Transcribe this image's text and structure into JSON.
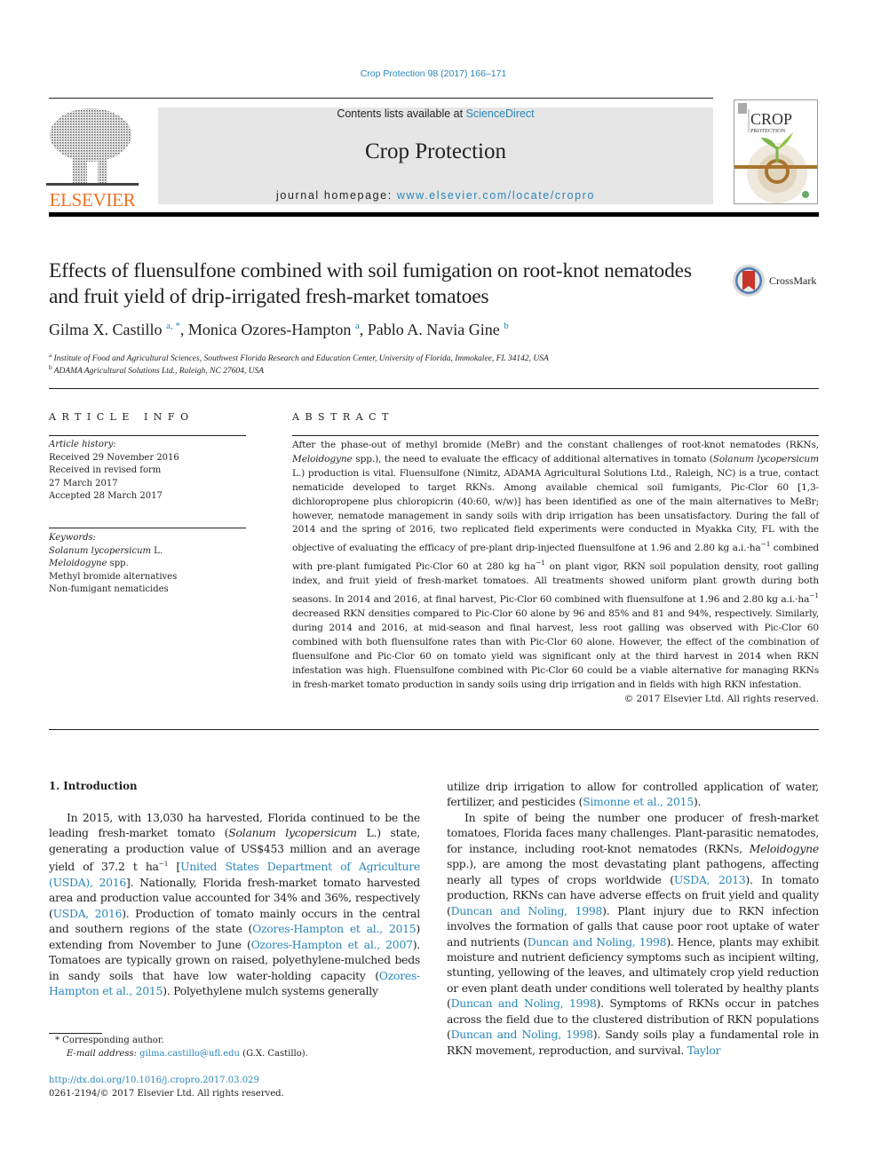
{
  "header": {
    "journal_ref": "Crop Protection 98 (2017) 166–171",
    "contents_prefix": "Contents lists available at ",
    "contents_link": "ScienceDirect",
    "journal_title": "Crop Protection",
    "homepage_prefix": "journal homepage: ",
    "homepage_link": "www.elsevier.com/locate/cropro",
    "publisher_logo_text": "ELSEVIER",
    "cover": {
      "title_line1": "CROP",
      "title_line2": "PROTECTION"
    },
    "crossmark_label": "CrossMark",
    "colors": {
      "link": "#2a86b8",
      "elsevier_orange": "#f37021",
      "masthead_bg": "#e6e6e6"
    }
  },
  "article": {
    "title": "Effects of fluensulfone combined with soil fumigation on root-knot nematodes and fruit yield of drip-irrigated fresh-market tomatoes",
    "authors": [
      {
        "name": "Gilma X. Castillo",
        "marks": "a, *"
      },
      {
        "name": "Monica Ozores-Hampton",
        "marks": "a"
      },
      {
        "name": "Pablo A. Navia Gine",
        "marks": "b"
      }
    ],
    "affiliations": [
      {
        "mark": "a",
        "text": "Institute of Food and Agricultural Sciences, Southwest Florida Research and Education Center, University of Florida, Immokalee, FL 34142, USA"
      },
      {
        "mark": "b",
        "text": "ADAMA Agricultural Solutions Ltd., Raleigh, NC 27604, USA"
      }
    ]
  },
  "article_info": {
    "heading": "ARTICLE INFO",
    "history_label": "Article history:",
    "history": [
      "Received 29 November 2016",
      "Received in revised form",
      "27 March 2017",
      "Accepted 28 March 2017"
    ],
    "keywords_label": "Keywords:",
    "keywords": [
      {
        "italic": "Solanum lycopersicum",
        "rest": " L."
      },
      {
        "italic": "Meloidogyne",
        "rest": " spp."
      },
      {
        "italic": "",
        "rest": "Methyl bromide alternatives"
      },
      {
        "italic": "",
        "rest": "Non-fumigant nematicides"
      }
    ]
  },
  "abstract": {
    "heading": "ABSTRACT",
    "p1": "After the phase-out of methyl bromide (MeBr) and the constant challenges of root-knot nematodes (RKNs, ",
    "p1_it": "Meloidogyne",
    "p2": " spp.), the need to evaluate the efficacy of additional alternatives in tomato (",
    "p2_it": "Solanum lycopersicum",
    "p3": " L.) production is vital. Fluensulfone (Nimitz, ADAMA Agricultural Solutions Ltd., Raleigh, NC) is a true, contact nematicide developed to target RKNs. Among available chemical soil fumigants, Pic-Clor 60 [1,3-dichloropropene plus chloropicrin (40:60, w/w)] has been identified as one of the main alternatives to MeBr; however, nematode management in sandy soils with drip irrigation has been unsatisfactory. During the fall of 2014 and the spring of 2016, two replicated field experiments were conducted in Myakka City, FL with the objective of evaluating the efficacy of pre-plant drip-injected fluensulfone at 1.96 and 2.80 kg a.i.·ha",
    "p4": " combined with pre-plant fumigated Pic-Clor 60 at 280 kg ha",
    "p5": " on plant vigor, RKN soil population density, root galling index, and fruit yield of fresh-market tomatoes. All treatments showed uniform plant growth during both seasons. In 2014 and 2016, at final harvest, Pic-Clor 60 combined with fluensulfone at 1.96 and 2.80 kg a.i.·ha",
    "p6": " decreased RKN densities compared to Pic-Clor 60 alone by 96 and 85% and 81 and 94%, respectively. Similarly, during 2014 and 2016, at mid-season and final harvest, less root galling was observed with Pic-Clor 60 combined with both fluensulfone rates than with Pic-Clor 60 alone. However, the effect of the combination of fluensulfone and Pic-Clor 60 on tomato yield was significant only at the third harvest in 2014 when RKN infestation was high. Fluensulfone combined with Pic-Clor 60 could be a viable alternative for managing RKNs in fresh-market tomato production in sandy soils using drip irrigation and in fields with high RKN infestation.",
    "exp": "−1",
    "copyright": "© 2017 Elsevier Ltd. All rights reserved."
  },
  "intro": {
    "heading": "1.  Introduction",
    "left": {
      "t1": "In 2015, with 13,030 ha harvested, Florida continued to be the leading fresh-market tomato (",
      "t1_it": "Solanum lycopersicum",
      "t2": " L.) state, generating a production value of US$453 million and an average yield of 37.2 t ha",
      "t2_sup": "−1",
      "t3": " [",
      "c1": "United States Department of Agriculture (USDA), 2016",
      "t4": "]. Nationally, Florida fresh-market tomato harvested area and production value accounted for 34% and 36%, respectively (",
      "c2": "USDA, 2016",
      "t5": "). Production of tomato mainly occurs in the central and southern regions of the state (",
      "c3": "Ozores-Hampton et al., 2015",
      "t6": ") extending from November to June (",
      "c4": "Ozores-Hampton et al., 2007",
      "t7": "). Tomatoes are typically grown on raised, polyethylene-mulched beds in sandy soils that have low water-holding capacity (",
      "c5": "Ozores-Hampton et al., 2015",
      "t8": "). Polyethylene mulch systems generally"
    },
    "right": {
      "t1": "utilize drip irrigation to allow for controlled application of water, fertilizer, and pesticides (",
      "c1": "Simonne et al., 2015",
      "t2": ").",
      "t3": "In spite of being the number one producer of fresh-market tomatoes, Florida faces many challenges. Plant-parasitic nematodes, for instance, including root-knot nematodes (RKNs, ",
      "t3_it": "Meloidogyne",
      "t4": " spp.), are among the most devastating plant pathogens, affecting nearly all types of crops worldwide (",
      "c2": "USDA, 2013",
      "t5": "). In tomato production, RKNs can have adverse effects on fruit yield and quality (",
      "c3": "Duncan and Noling, 1998",
      "t6": "). Plant injury due to RKN infection involves the formation of galls that cause poor root uptake of water and nutrients (",
      "c4": "Duncan and Noling, 1998",
      "t7": "). Hence, plants may exhibit moisture and nutrient deficiency symptoms such as incipient wilting, stunting, yellowing of the leaves, and ultimately crop yield reduction or even plant death under conditions well tolerated by healthy plants (",
      "c5": "Duncan and Noling, 1998",
      "t8": "). Symptoms of RKNs occur in patches across the field due to the clustered distribution of RKN populations (",
      "c6": "Duncan and Noling, 1998",
      "t9": "). Sandy soils play a fundamental role in RKN movement, reproduction, and survival. ",
      "c7": "Taylor"
    }
  },
  "footnotes": {
    "corr_mark": "*",
    "corr_text": " Corresponding author.",
    "email_label": "E-mail address: ",
    "email": "gilma.castillo@ufl.edu",
    "email_suffix": " (G.X. Castillo).",
    "doi": "http://dx.doi.org/10.1016/j.cropro.2017.03.029",
    "issn": "0261-2194/© 2017 Elsevier Ltd. All rights reserved."
  }
}
